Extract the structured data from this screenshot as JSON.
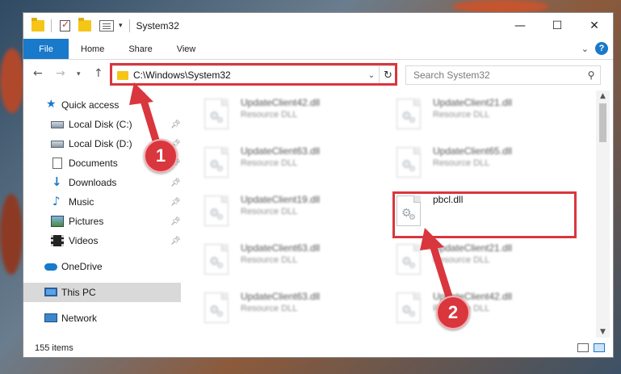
{
  "window": {
    "title": "System32",
    "controls": {
      "minimize": "—",
      "maximize": "☐",
      "close": "✕"
    }
  },
  "ribbon": {
    "tabs": [
      "File",
      "Home",
      "Share",
      "View"
    ],
    "help": "?"
  },
  "address": {
    "path": "C:\\Windows\\System32",
    "search_placeholder": "Search System32"
  },
  "sidebar": {
    "quick_access": "Quick access",
    "items": [
      {
        "label": "Local Disk (C:)",
        "icon": "drive-icon",
        "pinned": true
      },
      {
        "label": "Local Disk (D:)",
        "icon": "drive-icon",
        "pinned": true
      },
      {
        "label": "Documents",
        "icon": "documents-icon",
        "pinned": true
      },
      {
        "label": "Downloads",
        "icon": "download-icon",
        "pinned": true
      },
      {
        "label": "Music",
        "icon": "music-icon",
        "pinned": true
      },
      {
        "label": "Pictures",
        "icon": "pictures-icon",
        "pinned": true
      },
      {
        "label": "Videos",
        "icon": "videos-icon",
        "pinned": true
      }
    ],
    "onedrive": "OneDrive",
    "this_pc": "This PC",
    "network": "Network"
  },
  "files": [
    {
      "name": "UpdateClient42.dll",
      "type": "Resource DLL",
      "blurred": true
    },
    {
      "name": "UpdateClient21.dll",
      "type": "Resource DLL",
      "blurred": true
    },
    {
      "name": "UpdateClient63.dll",
      "type": "Resource DLL",
      "blurred": true
    },
    {
      "name": "UpdateClient65.dll",
      "type": "Resource DLL",
      "blurred": true
    },
    {
      "name": "UpdateClient19.dll",
      "type": "Resource DLL",
      "blurred": true
    },
    {
      "name": "pbcl.dll",
      "type": "",
      "blurred": false
    },
    {
      "name": "UpdateClient63.dll",
      "type": "Resource DLL",
      "blurred": true
    },
    {
      "name": "UpdateClient21.dll",
      "type": "Resource DLL",
      "blurred": true
    },
    {
      "name": "UpdateClient63.dll",
      "type": "Resource DLL",
      "blurred": true
    },
    {
      "name": "UpdateClient42.dll",
      "type": "Resource DLL",
      "blurred": true
    }
  ],
  "status": {
    "item_count": "155 items"
  },
  "callouts": {
    "first": "1",
    "second": "2"
  },
  "colors": {
    "accent": "#1979ca",
    "highlight": "#d9363e"
  }
}
